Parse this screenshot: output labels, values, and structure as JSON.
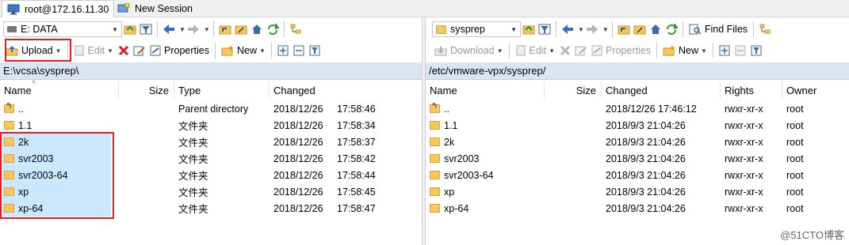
{
  "tabs": [
    {
      "label": "root@172.16.11.30",
      "icon": "monitor-icon"
    },
    {
      "label": "New Session",
      "icon": "new-session-icon"
    }
  ],
  "left": {
    "drive": "E: DATA",
    "path": "E:\\vcsa\\sysprep\\",
    "toolbar": {
      "upload": "Upload",
      "edit": "Edit",
      "properties": "Properties",
      "new": "New"
    },
    "columns": [
      "Name",
      "Size",
      "Type",
      "Changed"
    ],
    "rows": [
      {
        "name": "..",
        "size": "",
        "type": "Parent directory",
        "date": "2018/12/26",
        "time": "17:58:46",
        "up": true
      },
      {
        "name": "1.1",
        "size": "",
        "type": "文件夹",
        "date": "2018/12/26",
        "time": "17:58:34"
      },
      {
        "name": "2k",
        "size": "",
        "type": "文件夹",
        "date": "2018/12/26",
        "time": "17:58:37"
      },
      {
        "name": "svr2003",
        "size": "",
        "type": "文件夹",
        "date": "2018/12/26",
        "time": "17:58:42"
      },
      {
        "name": "svr2003-64",
        "size": "",
        "type": "文件夹",
        "date": "2018/12/26",
        "time": "17:58:44"
      },
      {
        "name": "xp",
        "size": "",
        "type": "文件夹",
        "date": "2018/12/26",
        "time": "17:58:45"
      },
      {
        "name": "xp-64",
        "size": "",
        "type": "文件夹",
        "date": "2018/12/26",
        "time": "17:58:47"
      }
    ]
  },
  "right": {
    "folder": "sysprep",
    "path": "/etc/vmware-vpx/sysprep/",
    "toolbar": {
      "download": "Download",
      "edit": "Edit",
      "properties": "Properties",
      "new": "New",
      "find": "Find Files"
    },
    "columns": [
      "Name",
      "Size",
      "Changed",
      "Rights",
      "Owner"
    ],
    "rows": [
      {
        "name": "..",
        "changed": "2018/12/26 17:46:12",
        "rights": "rwxr-xr-x",
        "owner": "root",
        "up": true
      },
      {
        "name": "1.1",
        "changed": "2018/9/3 21:04:26",
        "rights": "rwxr-xr-x",
        "owner": "root"
      },
      {
        "name": "2k",
        "changed": "2018/9/3 21:04:26",
        "rights": "rwxr-xr-x",
        "owner": "root"
      },
      {
        "name": "svr2003",
        "changed": "2018/9/3 21:04:26",
        "rights": "rwxr-xr-x",
        "owner": "root"
      },
      {
        "name": "svr2003-64",
        "changed": "2018/9/3 21:04:26",
        "rights": "rwxr-xr-x",
        "owner": "root"
      },
      {
        "name": "xp",
        "changed": "2018/9/3 21:04:26",
        "rights": "rwxr-xr-x",
        "owner": "root"
      },
      {
        "name": "xp-64",
        "changed": "2018/9/3 21:04:26",
        "rights": "rwxr-xr-x",
        "owner": "root"
      }
    ]
  },
  "watermark": "@51CTO博客",
  "colors": {
    "selection": "#cce8ff",
    "highlight_box": "#e02020",
    "path_bar": "#dbe5f1",
    "folder": "#f6c75a"
  }
}
